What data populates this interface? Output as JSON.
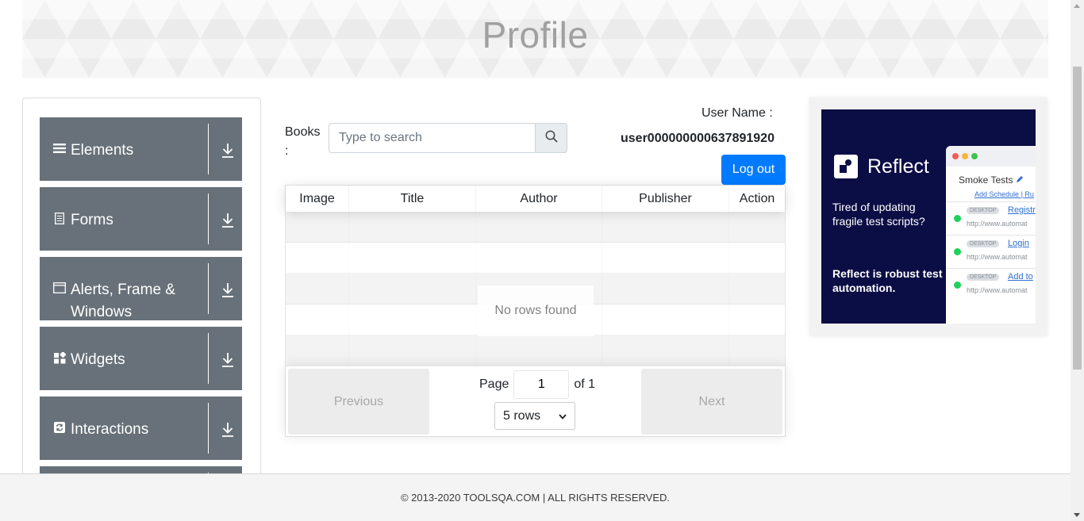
{
  "header": {
    "title": "Profile"
  },
  "sidebar": {
    "items": [
      {
        "label": "Elements",
        "icon": "list-icon"
      },
      {
        "label": "Forms",
        "icon": "form-icon"
      },
      {
        "label": "Alerts, Frame & Windows",
        "icon": "window-icon"
      },
      {
        "label": "Widgets",
        "icon": "widgets-icon"
      },
      {
        "label": "Interactions",
        "icon": "interactions-icon"
      }
    ]
  },
  "books": {
    "label": "Books :",
    "search_placeholder": "Type to search"
  },
  "user": {
    "label": "User Name :",
    "value": "user000000000637891920",
    "logout_label": "Log out"
  },
  "table": {
    "columns": [
      "Image",
      "Title",
      "Author",
      "Publisher",
      "Action"
    ],
    "empty_message": "No rows found",
    "pagination": {
      "previous_label": "Previous",
      "next_label": "Next",
      "page_label": "Page",
      "page_value": "1",
      "of_label": "of 1",
      "rows_option": "5 rows"
    }
  },
  "ad": {
    "brand": "Reflect",
    "tagline": "Tired of updating fragile test scripts?",
    "strong": "Reflect is robust test automation.",
    "window_title": "Smoke Tests",
    "schedule": "Add Schedule",
    "schedule_suffix": "| Ru",
    "items": [
      {
        "tag": "DESKTOP",
        "link": "Registr",
        "url": "http://www.automat"
      },
      {
        "tag": "DESKTOP",
        "link": "Login",
        "url": "http://www.automat"
      },
      {
        "tag": "DESKTOP",
        "link": "Add to",
        "url": "http://www.automat"
      }
    ]
  },
  "footer": {
    "text": "© 2013-2020 TOOLSQA.COM | ALL RIGHTS RESERVED."
  },
  "colors": {
    "sidebar_bg": "#687179",
    "primary": "#007bff",
    "ad_bg": "#0b0d45"
  }
}
